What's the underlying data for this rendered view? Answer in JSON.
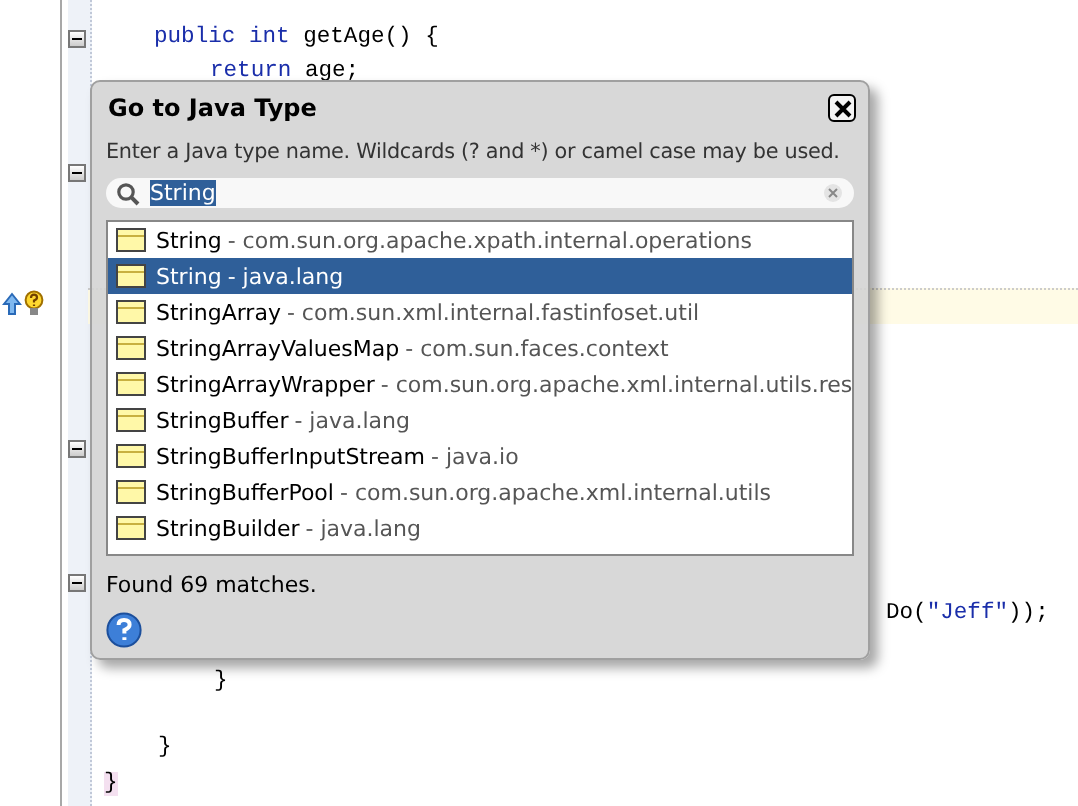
{
  "editor": {
    "lines": [
      {
        "tokens": [
          {
            "kind": "keyword",
            "text": "public int"
          },
          {
            "kind": "plain",
            "text": " getAge() {"
          }
        ]
      },
      {
        "tokens": [
          {
            "kind": "keyword",
            "text": "return"
          },
          {
            "kind": "plain",
            "text": " age;"
          }
        ]
      },
      {
        "tokens": [
          {
            "kind": "plain",
            "text": "Do("
          },
          {
            "kind": "string",
            "text": "\"Jeff\""
          },
          {
            "kind": "plain",
            "text": "));"
          }
        ]
      },
      {
        "tokens": [
          {
            "kind": "plain",
            "text": "}"
          }
        ]
      },
      {
        "tokens": [
          {
            "kind": "plain",
            "text": "}"
          }
        ]
      },
      {
        "tokens": [
          {
            "kind": "plain",
            "text": "}"
          }
        ]
      }
    ]
  },
  "dialog": {
    "title": "Go to Java Type",
    "hint": "Enter a Java type name.  Wildcards (? and *) or camel case may be used.",
    "search": {
      "value": "String"
    },
    "results": [
      {
        "name": "String",
        "package": "- com.sun.org.apache.xpath.internal.operations",
        "selected": false
      },
      {
        "name": "String",
        "package": "- java.lang",
        "selected": true
      },
      {
        "name": "StringArray",
        "package": "- com.sun.xml.internal.fastinfoset.util",
        "selected": false
      },
      {
        "name": "StringArrayValuesMap",
        "package": "- com.sun.faces.context",
        "selected": false
      },
      {
        "name": "StringArrayWrapper",
        "package": "- com.sun.org.apache.xml.internal.utils.res",
        "selected": false
      },
      {
        "name": "StringBuffer",
        "package": "- java.lang",
        "selected": false
      },
      {
        "name": "StringBufferInputStream",
        "package": "- java.io",
        "selected": false
      },
      {
        "name": "StringBufferPool",
        "package": "- com.sun.org.apache.xml.internal.utils",
        "selected": false
      },
      {
        "name": "StringBuilder",
        "package": "- java.lang",
        "selected": false
      }
    ],
    "status": "Found 69 matches."
  }
}
